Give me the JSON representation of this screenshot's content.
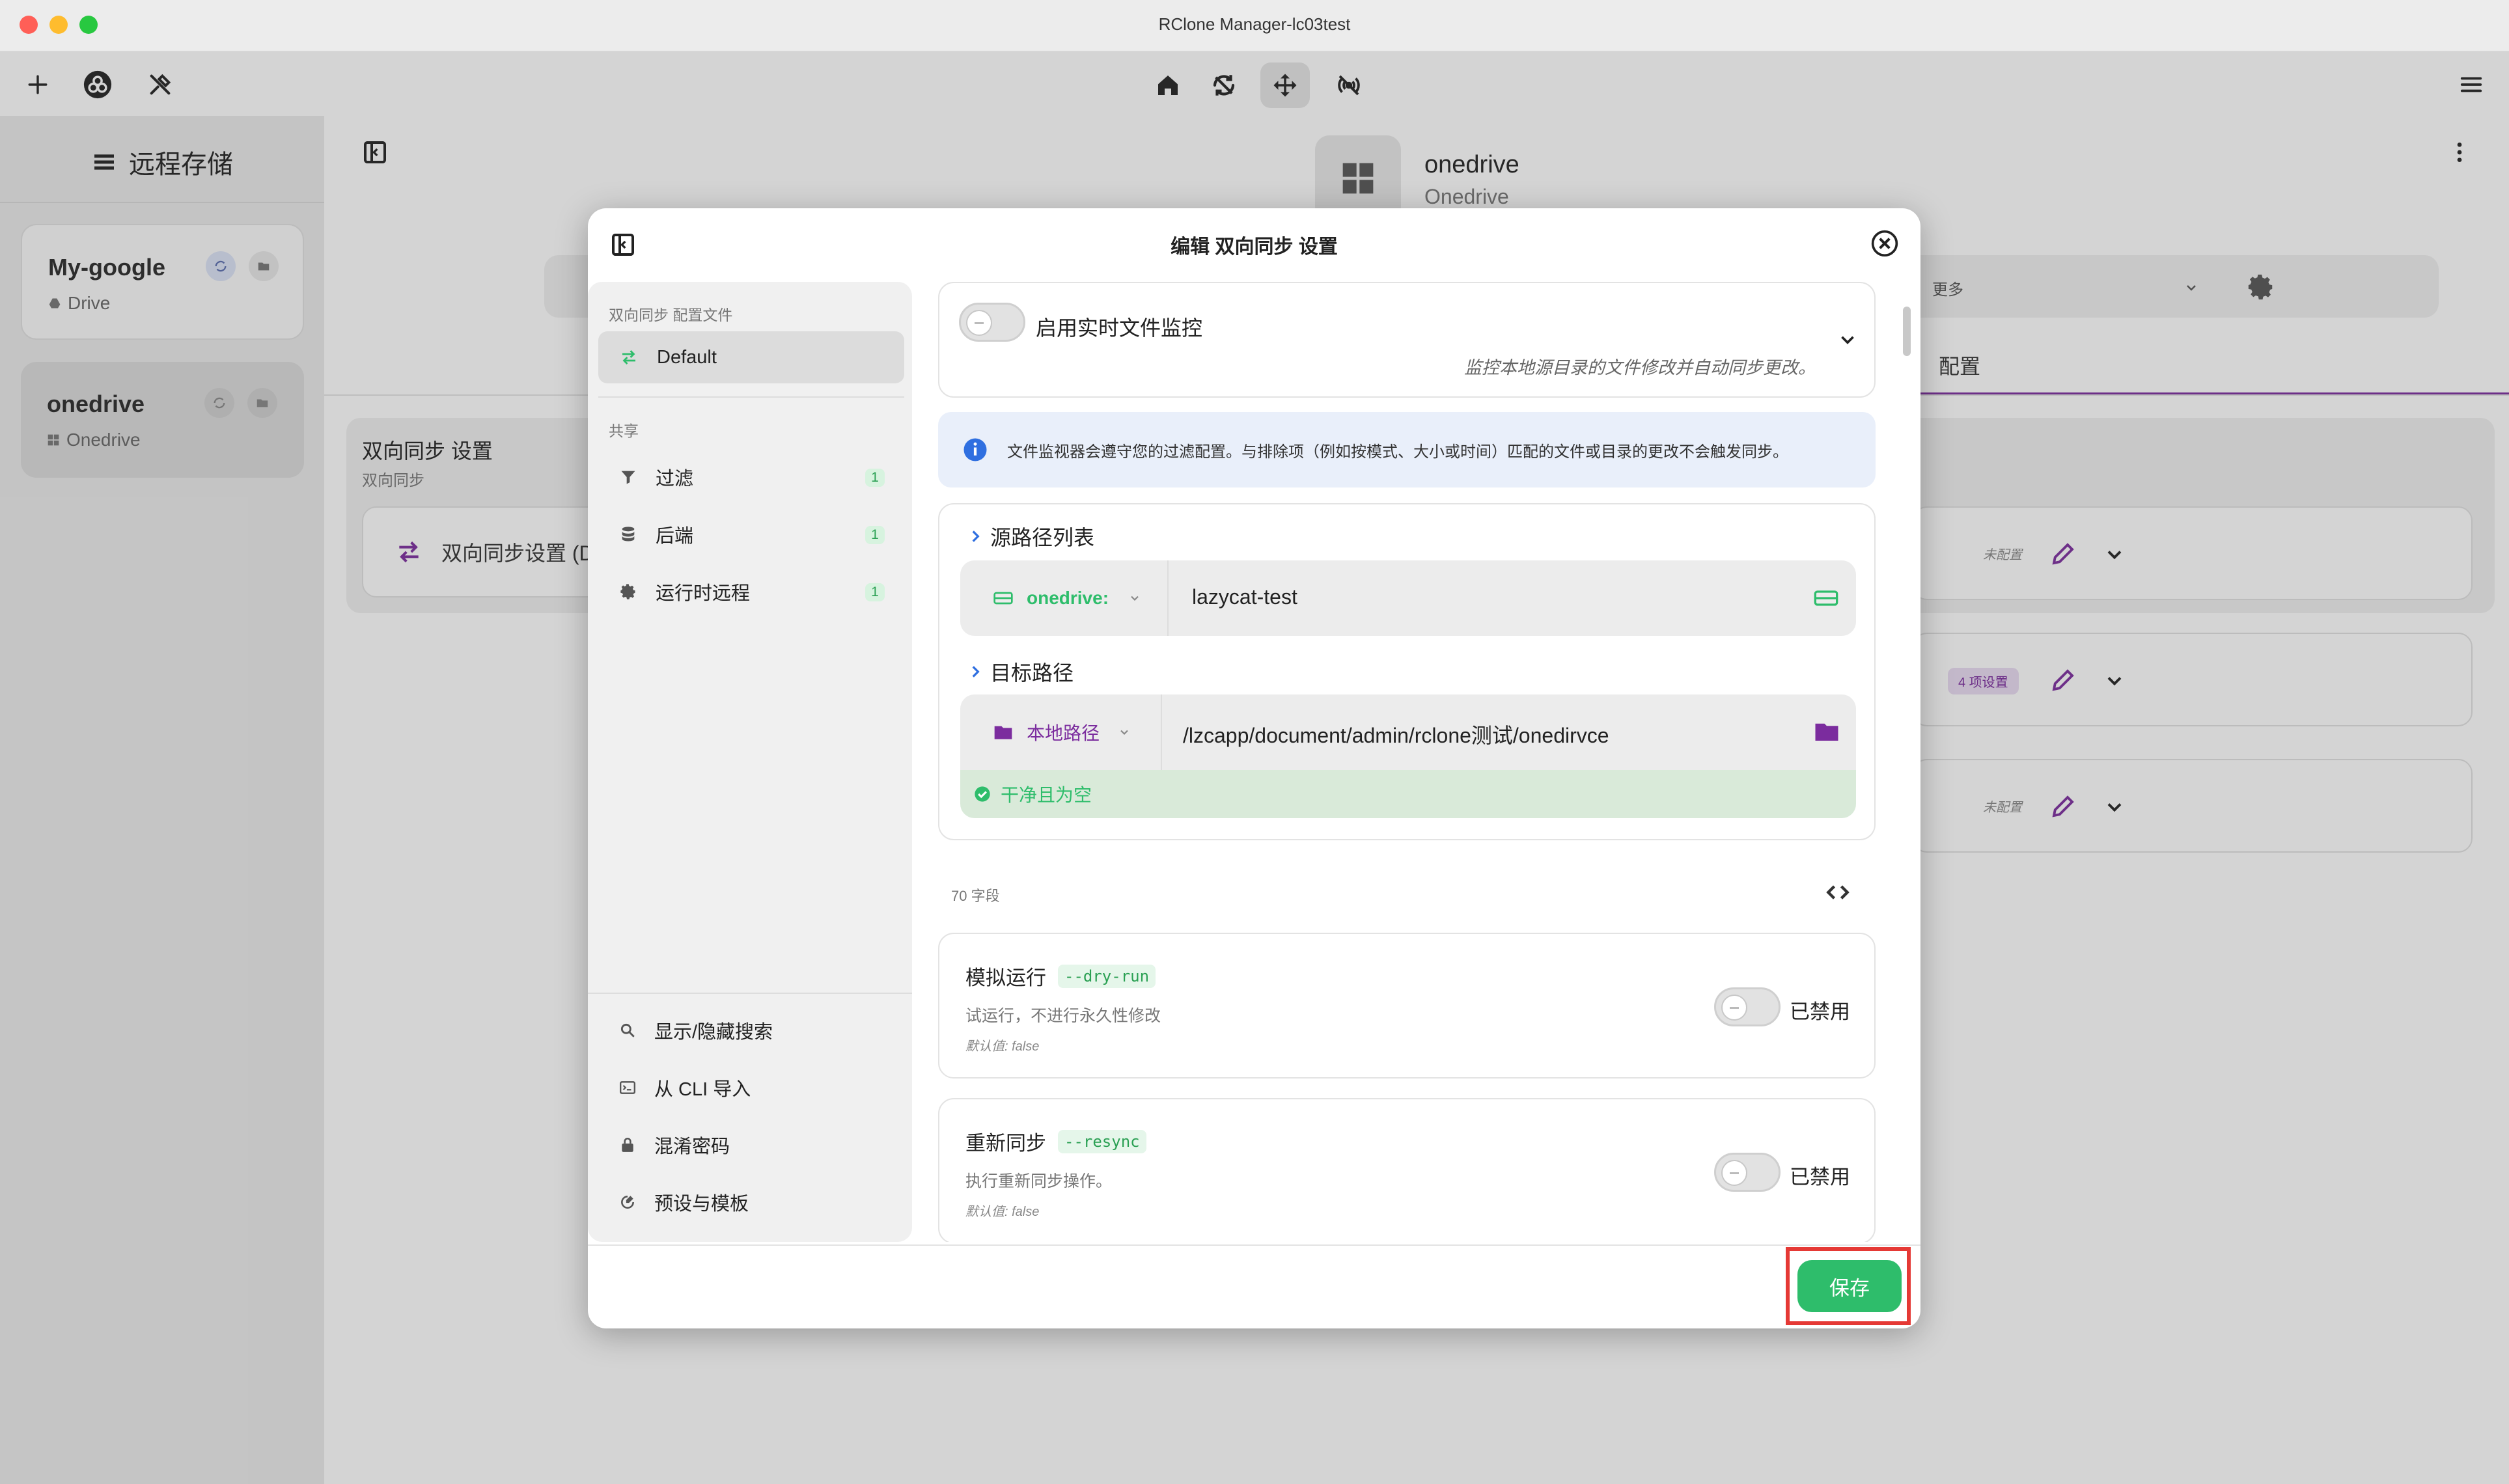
{
  "window": {
    "title": "RClone Manager-lc03test"
  },
  "colors": {
    "accent": "#2ebd6b",
    "purple": "#7b2c9e",
    "highlight": "#e53935"
  },
  "toolbar": {
    "left_icons": [
      "plus-icon",
      "rclone-logo-icon",
      "tools-icon"
    ],
    "center_icons": [
      "home-icon",
      "sync-icon",
      "move-icon",
      "serve-icon"
    ],
    "right_icons": [
      "hamburger-menu-icon"
    ]
  },
  "sidebar": {
    "title": "远程存储",
    "remotes": [
      {
        "name": "My-google",
        "type": "Drive"
      },
      {
        "name": "onedrive",
        "type": "Onedrive"
      }
    ]
  },
  "main": {
    "remote_name": "onedrive",
    "remote_type": "Onedrive",
    "more_label": "更多",
    "tab_config": "配置",
    "section_title": "双向同步 设置",
    "section_sub": "双向同步",
    "item_label": "双向同步设置 (D",
    "rows": [
      {
        "badge": "未配置"
      },
      {
        "badge": "4 项设置"
      },
      {
        "badge": "未配置"
      }
    ]
  },
  "modal": {
    "title": "编辑 双向同步 设置",
    "profiles_head": "双向同步 配置文件",
    "profile": "Default",
    "shared_head": "共享",
    "shared_items": [
      {
        "label": "过滤",
        "count": "1"
      },
      {
        "label": "后端",
        "count": "1"
      },
      {
        "label": "运行时远程",
        "count": "1"
      }
    ],
    "bottom_items": [
      {
        "label": "显示/隐藏搜索"
      },
      {
        "label": "从 CLI 导入"
      },
      {
        "label": "混淆密码"
      },
      {
        "label": "预设与模板"
      }
    ],
    "watch": {
      "label": "启用实时文件监控",
      "desc": "监控本地源目录的文件修改并自动同步更改。"
    },
    "info": "文件监视器会遵守您的过滤配置。与排除项（例如按模式、大小或时间）匹配的文件或目录的更改不会触发同步。",
    "source": {
      "heading": "源路径列表",
      "remote": "onedrive:",
      "path": "lazycat-test"
    },
    "target": {
      "heading": "目标路径",
      "remote": "本地路径",
      "path": "/lzcapp/document/admin/rclone测试/onedirvce",
      "status": "干净且为空"
    },
    "fields_count": "70 字段",
    "fields": [
      {
        "name": "模拟运行",
        "flag": "--dry-run",
        "desc": "试运行，不进行永久性修改",
        "default": "默认值: false",
        "state": "已禁用"
      },
      {
        "name": "重新同步",
        "flag": "--resync",
        "desc": "执行重新同步操作。",
        "default": "默认值: false",
        "state": "已禁用"
      }
    ],
    "save": "保存"
  }
}
